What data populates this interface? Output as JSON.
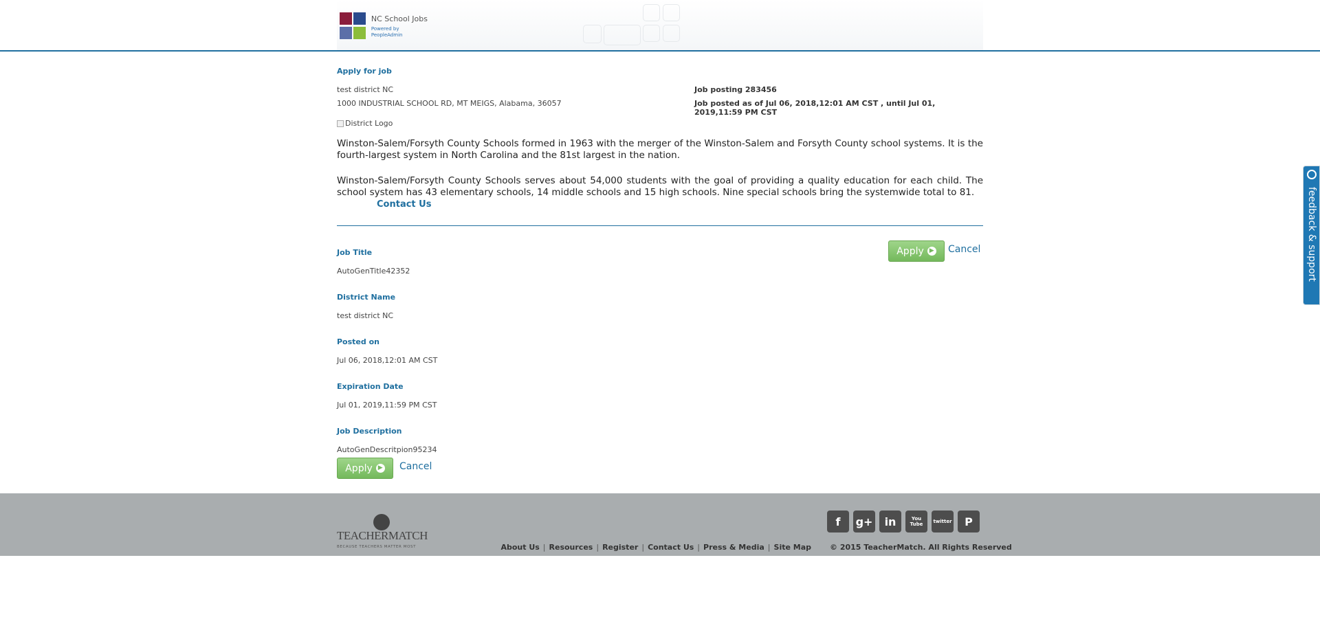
{
  "header": {
    "logo_title": "NC School Jobs",
    "logo_sub": "Powered by PeopleAdmin"
  },
  "job": {
    "heading": "Apply for job",
    "district_name": "test district NC",
    "district_address": "1000 INDUSTRIAL SCHOOL RD, MT MEIGS, Alabama, 36057",
    "posting_number": "Job posting 283456",
    "posted_range": "Job posted as of Jul 06, 2018,12:01 AM CST , until Jul 01, 2019,11:59 PM CST",
    "district_logo_alt": "District Logo",
    "description_p1": "Winston-Salem/Forsyth County Schools formed in 1963 with the merger of the Winston-Salem and Forsyth County school systems. It is the fourth-largest system in North Carolina and the 81st largest in the nation.",
    "description_p2": "Winston-Salem/Forsyth County Schools serves about 54,000 students with the goal of providing a quality education for each child. The school system has 43 elementary schools, 14 middle schools and 15 high schools. Nine special schools bring the systemwide total to 81.",
    "contact_label": "Contact Us"
  },
  "fields": {
    "job_title_label": "Job Title",
    "job_title_value": "AutoGenTitle42352",
    "district_label": "District Name",
    "district_value": "test district NC",
    "posted_label": "Posted on",
    "posted_value": "Jul 06, 2018,12:01 AM CST",
    "expiration_label": "Expiration Date",
    "expiration_value": "Jul 01, 2019,11:59 PM CST",
    "description_label": "Job Description",
    "description_value": "AutoGenDescritpion95234"
  },
  "actions": {
    "apply_label": "Apply",
    "cancel_label": "Cancel"
  },
  "footer": {
    "brand": "TEACHERMATCH",
    "tagline": "BECAUSE TEACHERS MATTER MOST",
    "social": [
      "f",
      "g+",
      "in",
      "You Tube",
      "twitter",
      "P"
    ],
    "links": [
      "About Us",
      "Resources",
      "Register",
      "Contact Us",
      "Press & Media",
      "Site Map"
    ],
    "copyright": "© 2015 TeacherMatch. All Rights Reserved"
  },
  "feedback": {
    "label": "feedback & support"
  }
}
